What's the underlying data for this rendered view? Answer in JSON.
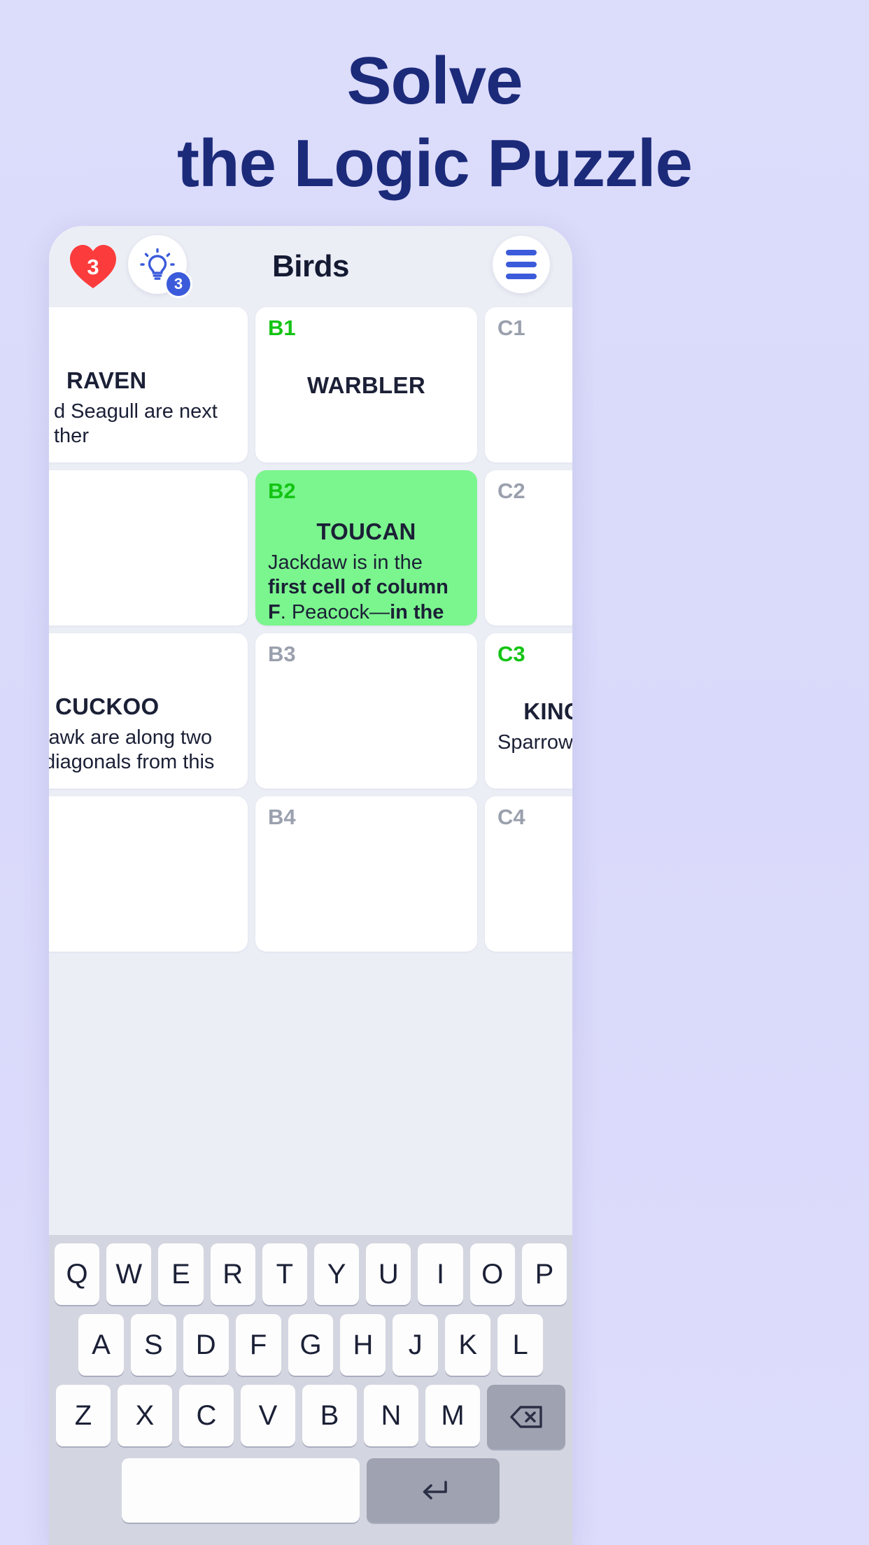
{
  "promo": {
    "headline_line1": "Solve",
    "headline_line2": "the Logic Puzzle",
    "headline_color": "#1c2a7a",
    "background_color": "#dcdcfb"
  },
  "appbar": {
    "lives_count": "3",
    "lives_color": "#fc3c3c",
    "hint_badge_count": "3",
    "hint_badge_color": "#3b5bdb",
    "title": "Birds",
    "menu_icon": "hamburger-icon",
    "hint_icon": "lightbulb-icon",
    "lives_icon": "heart-icon"
  },
  "board": {
    "solved_label_color": "#13c413",
    "unsolved_label_color": "#9aa0ad",
    "highlight_color": "#7bf58e",
    "cells": [
      {
        "id": "A1",
        "id_visible": false,
        "solved": true,
        "highlighted": false,
        "word": "RAVEN",
        "clue_plain": "d Seagull are next",
        "clue_line2": "ther",
        "clipped": true
      },
      {
        "id": "B1",
        "id_visible": true,
        "solved": true,
        "highlighted": false,
        "word": "WARBLER",
        "clue_plain": "",
        "clipped": false
      },
      {
        "id": "C1",
        "id_visible": true,
        "solved": false,
        "highlighted": false,
        "word": "",
        "clue_plain": "",
        "clipped": true
      },
      {
        "id": "A2",
        "id_visible": false,
        "solved": false,
        "highlighted": false,
        "word": "",
        "clue_plain": "",
        "clipped": true
      },
      {
        "id": "B2",
        "id_visible": true,
        "solved": true,
        "highlighted": true,
        "word": "TOUCAN",
        "clue_rich": [
          {
            "t": "Jackdaw is in the ",
            "b": false
          },
          {
            "t": "first cell of column F",
            "b": true
          },
          {
            "t": ". Peacock—",
            "b": false
          },
          {
            "t": "in the last",
            "b": true
          }
        ],
        "clipped": false
      },
      {
        "id": "C2",
        "id_visible": true,
        "solved": false,
        "highlighted": false,
        "word": "",
        "clue_plain": "",
        "clipped": true
      },
      {
        "id": "A3",
        "id_visible": false,
        "solved": true,
        "highlighted": false,
        "word": "CUCKOO",
        "clue_plain": "lawk are along two",
        "clue_line2": "diagonals from this",
        "clipped": true
      },
      {
        "id": "B3",
        "id_visible": true,
        "solved": false,
        "highlighted": false,
        "word": "",
        "clue_plain": "",
        "clipped": false
      },
      {
        "id": "C3",
        "id_visible": true,
        "solved": true,
        "highlighted": false,
        "word": "KINGFISHER",
        "clue_plain": "Sparrow is one cell",
        "clipped": true
      },
      {
        "id": "A4",
        "id_visible": false,
        "solved": false,
        "highlighted": false,
        "word": "",
        "clue_plain": "",
        "clipped": true
      },
      {
        "id": "B4",
        "id_visible": true,
        "solved": false,
        "highlighted": false,
        "word": "",
        "clue_plain": "",
        "clipped": false
      },
      {
        "id": "C4",
        "id_visible": true,
        "solved": false,
        "highlighted": false,
        "word": "",
        "clue_plain": "",
        "clipped": true
      }
    ]
  },
  "keyboard": {
    "row1": [
      "Q",
      "W",
      "E",
      "R",
      "T",
      "Y",
      "U",
      "I",
      "O",
      "P"
    ],
    "row2": [
      "A",
      "S",
      "D",
      "F",
      "G",
      "H",
      "J",
      "K",
      "L"
    ],
    "row3": [
      "Z",
      "X",
      "C",
      "V",
      "B",
      "N",
      "M"
    ],
    "backspace_icon": "backspace-icon",
    "enter_icon": "enter-return-icon",
    "space_label": ""
  }
}
